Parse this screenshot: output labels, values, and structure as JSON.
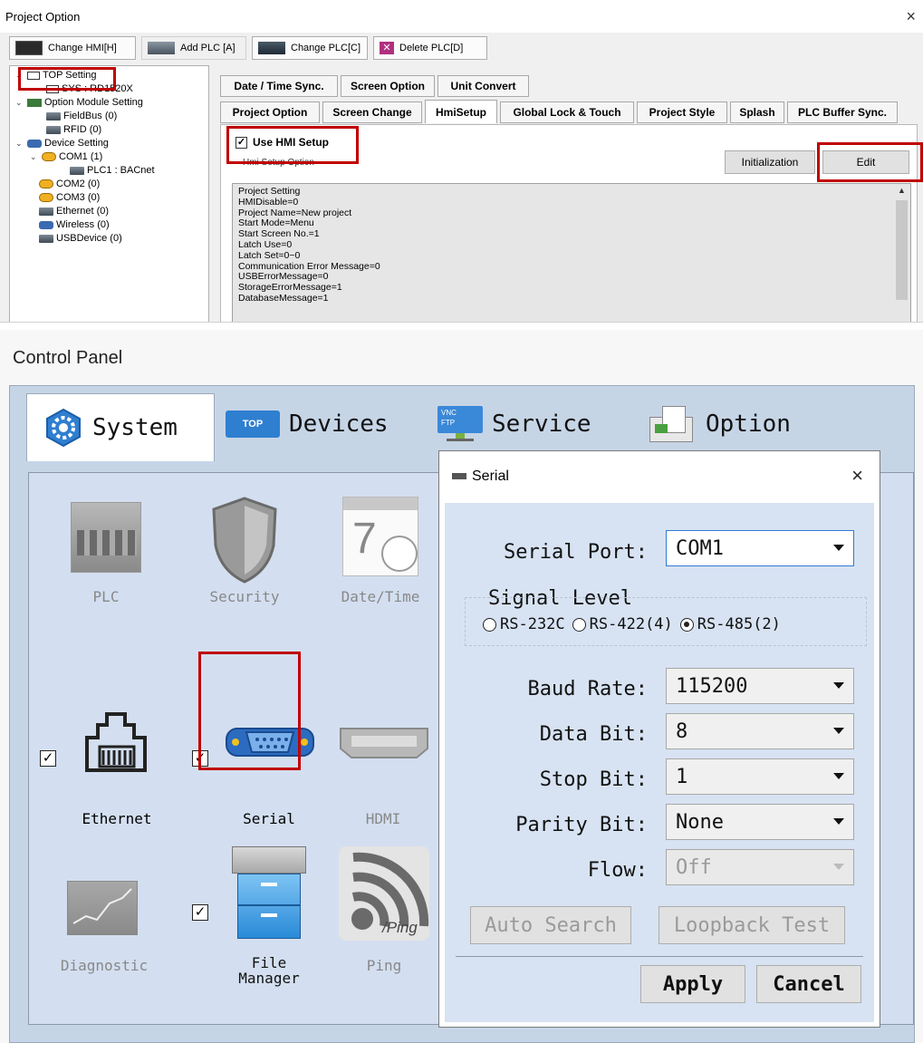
{
  "project_option": {
    "title": "Project Option",
    "close": "×",
    "toolbar": [
      {
        "label": "Change HMI[H]"
      },
      {
        "label": "Add PLC [A]"
      },
      {
        "label": "Change PLC[C]"
      },
      {
        "label": "Delete PLC[D]"
      }
    ],
    "tree": {
      "top_setting": "TOP Setting",
      "sys": "SYS : RD1520X",
      "option_module": "Option Module Setting",
      "fieldbus": "FieldBus (0)",
      "rfid": "RFID (0)",
      "device_setting": "Device Setting",
      "com1": "COM1 (1)",
      "plc1": "PLC1 : BACnet",
      "com2": "COM2 (0)",
      "com3": "COM3 (0)",
      "ethernet": "Ethernet (0)",
      "wireless": "Wireless (0)",
      "usbdevice": "USBDevice (0)"
    },
    "tabs_row1": [
      "Date / Time Sync.",
      "Screen Option",
      "Unit Convert"
    ],
    "tabs_row2": [
      "Project Option",
      "Screen Change",
      "HmiSetup",
      "Global Lock & Touch",
      "Project Style",
      "Splash",
      "PLC Buffer Sync."
    ],
    "use_hmi_setup": "Use HMI Setup",
    "group_label": "Hmi Setup Option",
    "init_button": "Initialization",
    "edit_button": "Edit",
    "settings": [
      "Project Setting",
      "HMIDisable=0",
      "Project Name=New project",
      "Start Mode=Menu",
      "Start Screen No.=1",
      "Latch Use=0",
      "Latch Set=0~0",
      "Communication Error Message=0",
      "USBErrorMessage=0",
      "StorageErrorMessage=1",
      "DatabaseMessage=1"
    ]
  },
  "control_panel": {
    "title": "Control Panel",
    "tabs": [
      "System",
      "Devices",
      "Service",
      "Option"
    ],
    "tab_icon_texts": {
      "devices": "TOP",
      "service_vnc": "VNC",
      "service_ftp": "FTP"
    },
    "apps": {
      "plc": "PLC",
      "security": "Security",
      "datetime": "Date/Time",
      "ethernet": "Ethernet",
      "serial": "Serial",
      "hdmi": "HDMI",
      "diagnostic": "Diagnostic",
      "file_manager_1": "File",
      "file_manager_2": "Manager",
      "ping": "Ping",
      "ping_icon_text": "/Ping",
      "calendar_number": "7"
    },
    "serial_dialog": {
      "title": "Serial",
      "close": "×",
      "serial_port_label": "Serial Port:",
      "serial_port_value": "COM1",
      "signal_level_label": "Signal Level",
      "signal_options": [
        "RS-232C",
        "RS-422(4)",
        "RS-485(2)"
      ],
      "signal_selected": "RS-485(2)",
      "baud_rate_label": "Baud Rate:",
      "baud_rate_value": "115200",
      "data_bit_label": "Data Bit:",
      "data_bit_value": "8",
      "stop_bit_label": "Stop Bit:",
      "stop_bit_value": "1",
      "parity_bit_label": "Parity Bit:",
      "parity_bit_value": "None",
      "flow_label": "Flow:",
      "flow_value": "Off",
      "auto_search": "Auto Search",
      "loopback_test": "Loopback Test",
      "apply": "Apply",
      "cancel": "Cancel"
    }
  },
  "colors": {
    "highlight_red": "#c00000",
    "panel_blue": "#c6d5e6",
    "dialog_body": "#d7e3f2",
    "focus_blue": "#2e7bd4"
  }
}
